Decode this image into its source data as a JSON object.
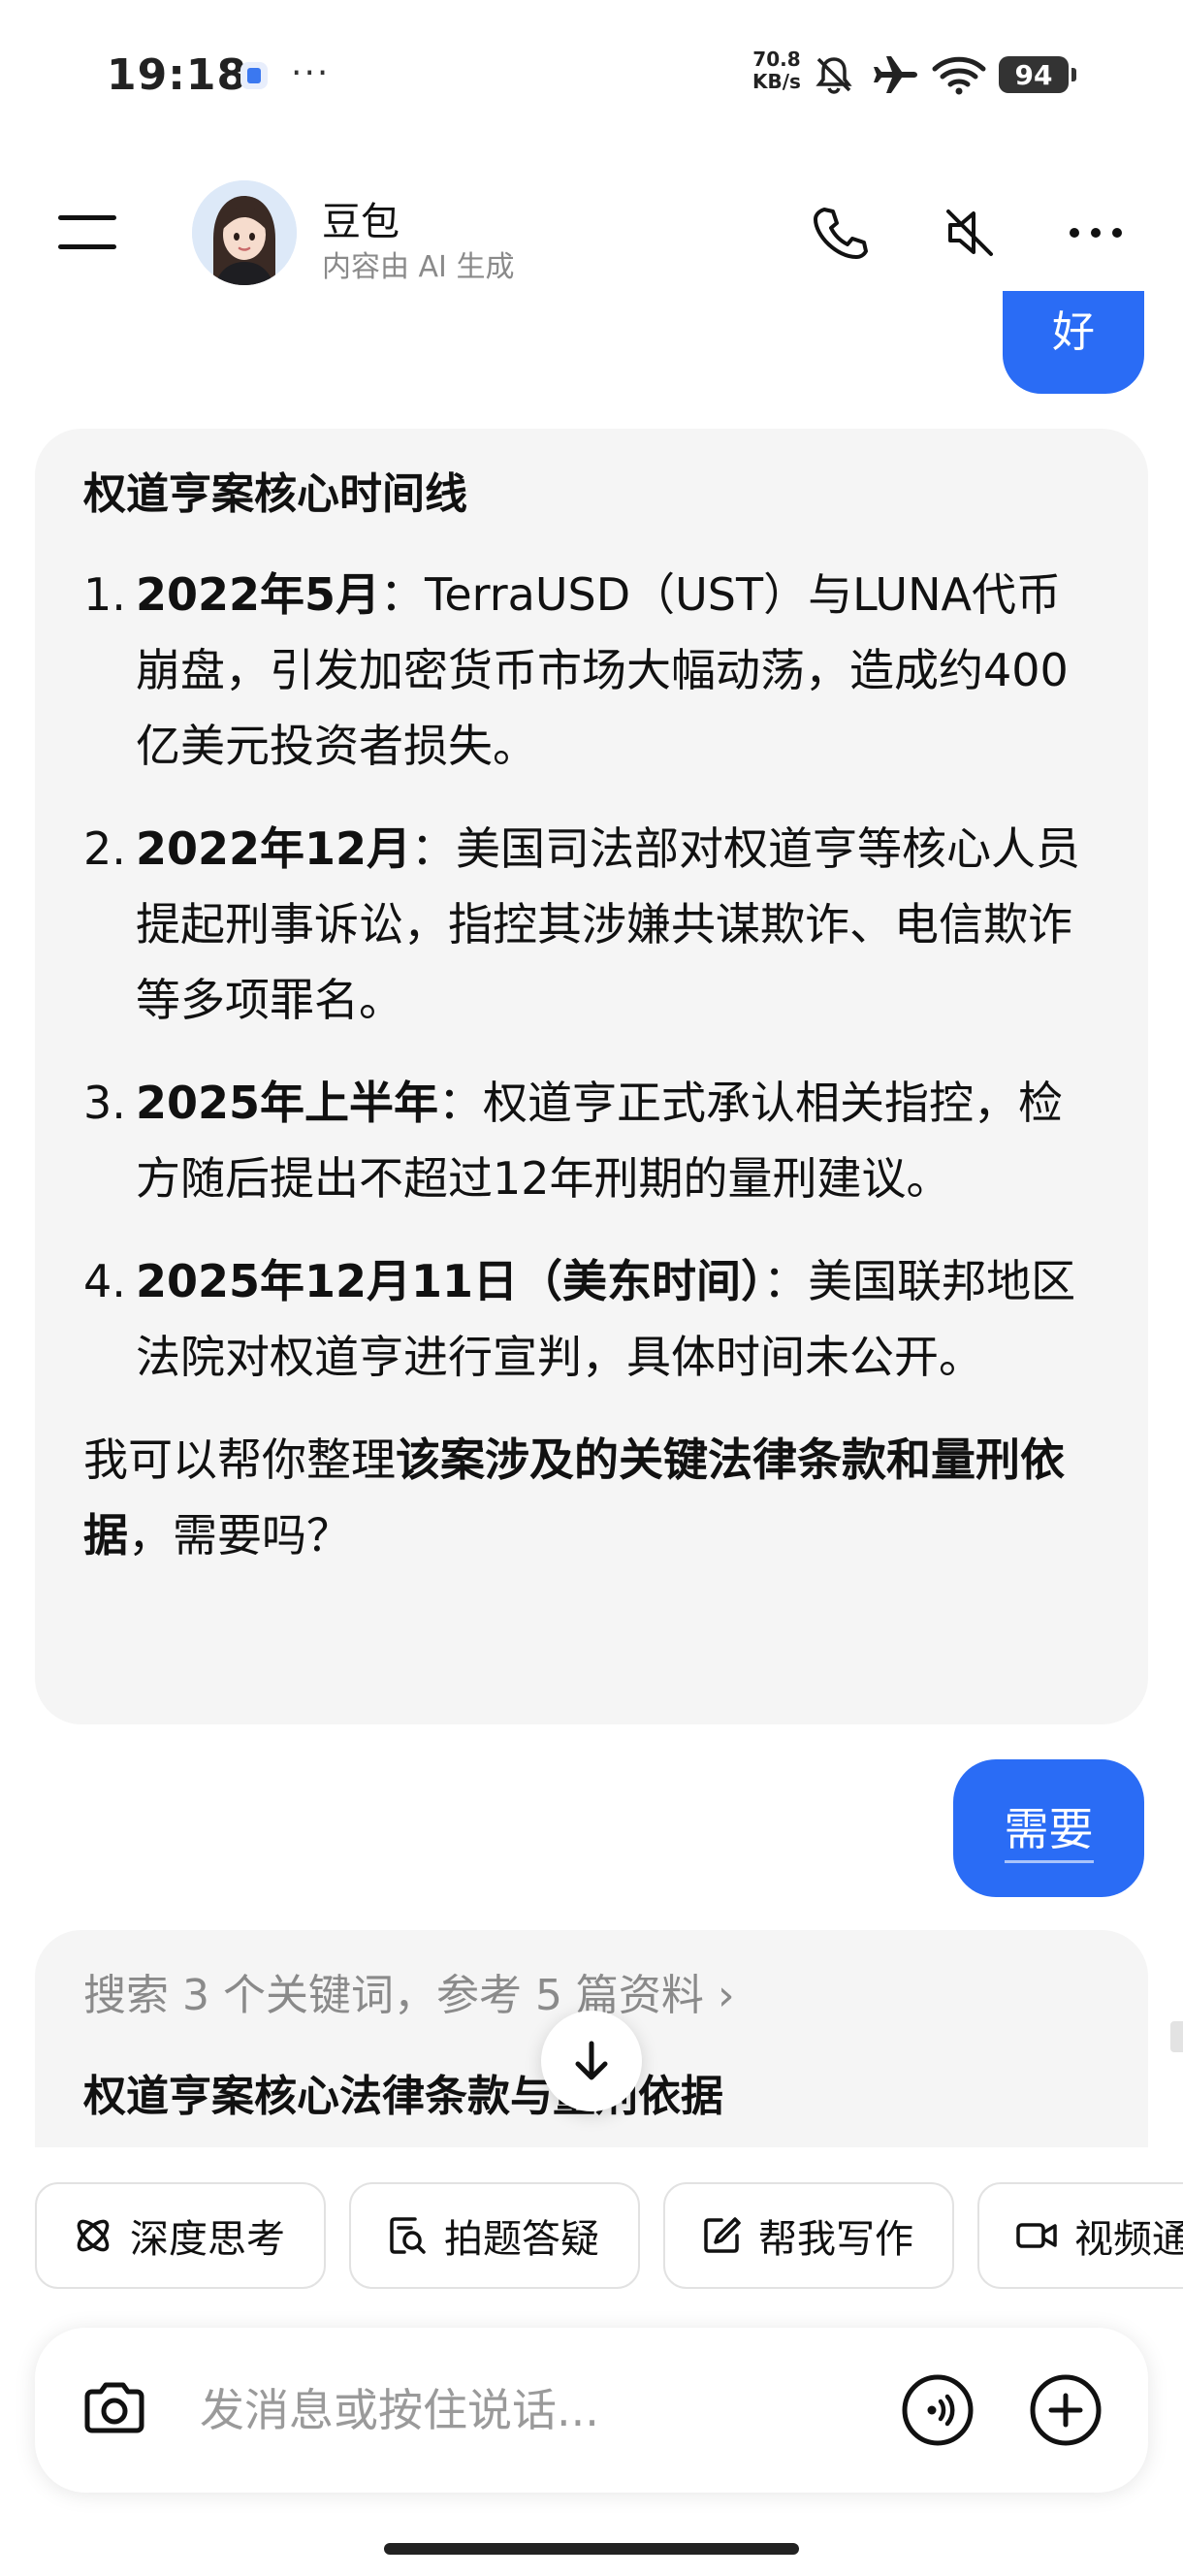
{
  "status_bar": {
    "time": "19:18",
    "more": "···",
    "speed_value": "70.8",
    "speed_unit": "KB/s",
    "battery": "94",
    "icons": [
      "app-notification-icon",
      "mute-bell-icon",
      "airplane-icon",
      "wifi-icon",
      "battery-icon"
    ]
  },
  "header": {
    "name": "豆包",
    "subtitle": "内容由 AI 生成",
    "icons": [
      "menu-icon",
      "phone-icon",
      "mute-speaker-icon",
      "more-icon"
    ]
  },
  "chat": {
    "prev_user_fragment": "好",
    "bot_card": {
      "title": "权道亨案核心时间线",
      "items": [
        {
          "num": "1.",
          "date": "2022年5月",
          "sep": "：",
          "text": "TerraUSD（UST）与LUNA代币崩盘，引发加密货币市场大幅动荡，造成约400亿美元投资者损失。"
        },
        {
          "num": "2.",
          "date": "2022年12月",
          "sep": "：",
          "text": "美国司法部对权道亨等核心人员提起刑事诉讼，指控其涉嫌共谋欺诈、电信欺诈等多项罪名。"
        },
        {
          "num": "3.",
          "date": "2025年上半年",
          "sep": "：",
          "text": "权道亨正式承认相关指控，检方随后提出不超过12年刑期的量刑建议。"
        },
        {
          "num": "4.",
          "date": "2025年12月11日（美东时间）",
          "sep": "：",
          "text": "美国联邦地区法院对权道亨进行宣判，具体时间未公开。"
        }
      ],
      "closing_pre": "我可以帮你整理",
      "closing_bold": "该案涉及的关键法律条款和量刑依据",
      "closing_post": "，需要吗？"
    },
    "user_reply": "需要",
    "search": {
      "summary": "搜索 3 个关键词，参考 5 篇资料",
      "chevron": "›",
      "answer_title": "权道亨案核心法律条款与量刑依据"
    }
  },
  "chips": [
    {
      "label": "深度思考",
      "icon": "atom-icon"
    },
    {
      "label": "拍题答疑",
      "icon": "photo-search-icon"
    },
    {
      "label": "帮我写作",
      "icon": "edit-icon"
    },
    {
      "label": "视频通话",
      "icon": "video-icon"
    }
  ],
  "input": {
    "placeholder": "发消息或按住说话..."
  },
  "colors": {
    "accent": "#2a6cf5",
    "card_bg": "#f5f5f5",
    "muted_text": "#8a8a8a"
  }
}
